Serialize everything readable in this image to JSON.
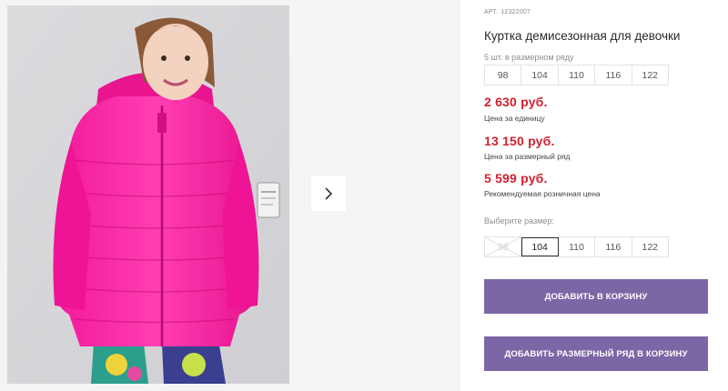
{
  "product": {
    "article_label": "АРТ.",
    "article": "12322007",
    "title": "Куртка демисезонная для девочки"
  },
  "size_set": {
    "label": "5 шт. в размерном ряду",
    "sizes": [
      "98",
      "104",
      "110",
      "116",
      "122"
    ]
  },
  "prices": [
    {
      "value": "2 630 руб.",
      "note": "Цена за единицу"
    },
    {
      "value": "13 150 руб.",
      "note": "Цена за размерный ряд"
    },
    {
      "value": "5 599 руб.",
      "note": "Рекомендуемая розничная цена"
    }
  ],
  "size_picker": {
    "label": "Выберите размер:",
    "sizes": [
      "98",
      "104",
      "110",
      "116",
      "122"
    ],
    "selected": "104",
    "unavailable": [
      "98"
    ]
  },
  "buttons": {
    "add_to_cart": "ДОБАВИТЬ В КОРЗИНУ",
    "add_set_to_cart": "ДОБАВИТЬ РАЗМЕРНЫЙ РЯД В КОРЗИНУ"
  },
  "colors": {
    "price": "#d3202f",
    "button": "#7b67a6",
    "jacket": "#ff1fa3"
  },
  "icons": {
    "gallery_next": "chevron-right-icon"
  }
}
